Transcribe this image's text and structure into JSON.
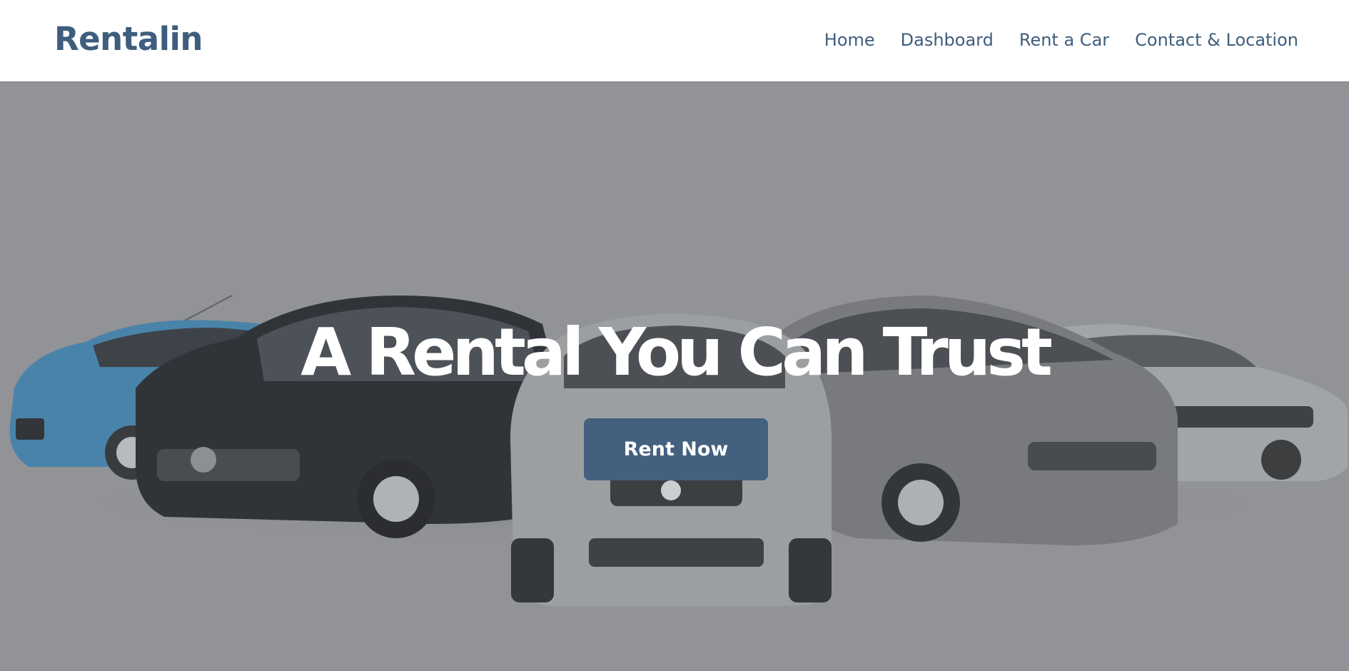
{
  "header": {
    "brand": "Rentalin",
    "nav": [
      {
        "label": "Home"
      },
      {
        "label": "Dashboard"
      },
      {
        "label": "Rent a Car"
      },
      {
        "label": "Contact & Location"
      }
    ]
  },
  "hero": {
    "headline": "A Rental You Can Trust",
    "cta_label": "Rent Now",
    "image_alt": "Lineup of rental cars"
  },
  "colors": {
    "brand": "#3f5d7d",
    "button": "#43607f",
    "overlay": "#929398",
    "nav_bg": "#ffffff"
  }
}
